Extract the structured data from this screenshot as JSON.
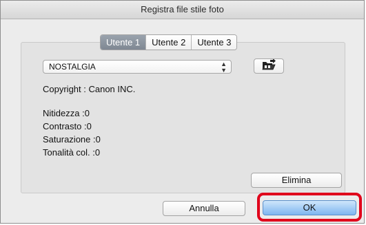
{
  "window": {
    "title": "Registra file stile foto"
  },
  "tabs": [
    {
      "label": "Utente 1",
      "active": true
    },
    {
      "label": "Utente 2",
      "active": false
    },
    {
      "label": "Utente 3",
      "active": false
    }
  ],
  "style_select": {
    "value": "NOSTALGIA",
    "arrow_up": "▲",
    "arrow_down": "▼"
  },
  "info": {
    "copyright": "Copyright : Canon INC.",
    "sharpness": "Nitidezza :0",
    "contrast": "Contrasto :0",
    "saturation": "Saturazione :0",
    "color_tone": "Tonalità col. :0"
  },
  "buttons": {
    "delete": "Elimina",
    "cancel": "Annulla",
    "ok": "OK"
  },
  "icons": {
    "open_file": "folder-open-icon"
  },
  "colors": {
    "highlight": "#e0001b",
    "ok_button": "#7eb6f0",
    "active_tab": "#8a939d"
  }
}
